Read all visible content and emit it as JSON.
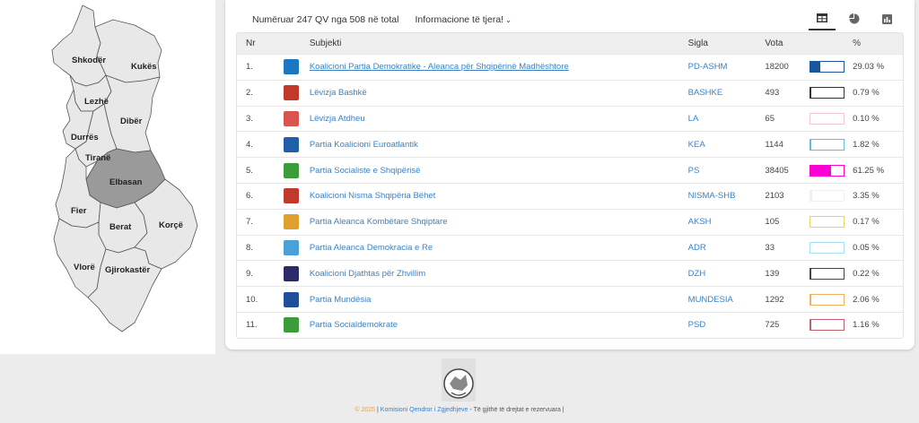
{
  "map": {
    "regions": [
      {
        "name": "Shkodër",
        "color": "#e8e8e8"
      },
      {
        "name": "Kukës",
        "color": "#e8e8e8"
      },
      {
        "name": "Lezhë",
        "color": "#e8e8e8"
      },
      {
        "name": "Dibër",
        "color": "#e8e8e8"
      },
      {
        "name": "Durrës",
        "color": "#e8e8e8"
      },
      {
        "name": "Tiranë",
        "color": "#e8e8e8"
      },
      {
        "name": "Elbasan",
        "color": "#9a9a9a"
      },
      {
        "name": "Fier",
        "color": "#e8e8e8"
      },
      {
        "name": "Berat",
        "color": "#e8e8e8"
      },
      {
        "name": "Korçë",
        "color": "#e8e8e8"
      },
      {
        "name": "Vlorë",
        "color": "#e8e8e8"
      },
      {
        "name": "Gjirokastër",
        "color": "#e8e8e8"
      }
    ]
  },
  "topbar": {
    "counted": "Numëruar 247 QV nga 508 në total",
    "more_info": "Informacione të tjera!"
  },
  "view_tabs": [
    {
      "icon": "table-icon",
      "active": true
    },
    {
      "icon": "pie-chart-icon",
      "active": false
    },
    {
      "icon": "bar-chart-icon",
      "active": false
    }
  ],
  "table": {
    "headers": {
      "nr": "Nr",
      "subjekti": "Subjekti",
      "sigla": "Sigla",
      "vota": "Vota",
      "pct": "%"
    },
    "rows": [
      {
        "nr": "1.",
        "subjekti": "Koalicioni Partia Demokratike - Aleanca për Shqipërinë Madhështore",
        "sigla": "PD-ASHM",
        "vota": "18200",
        "pct": "29.03 %",
        "share": 0.2903,
        "color": "#1a56a0",
        "logo_color": "#1a78c2"
      },
      {
        "nr": "2.",
        "subjekti": "Lëvizja Bashkë",
        "sigla": "BASHKE",
        "vota": "493",
        "pct": "0.79 %",
        "share": 0.0079,
        "color": "#333333",
        "logo_color": "#c0392b"
      },
      {
        "nr": "3.",
        "subjekti": "Lëvizja Atdheu",
        "sigla": "LA",
        "vota": "65",
        "pct": "0.10 %",
        "share": 0.001,
        "color": "#f0c8d0",
        "logo_color": "#d9534f"
      },
      {
        "nr": "4.",
        "subjekti": "Partia Koalicioni Euroatlantik",
        "sigla": "KEA",
        "vota": "1144",
        "pct": "1.82 %",
        "share": 0.0182,
        "color": "#5bc0de",
        "logo_color": "#1f5fa8"
      },
      {
        "nr": "5.",
        "subjekti": "Partia Socialiste e Shqipërisë",
        "sigla": "PS",
        "vota": "38405",
        "pct": "61.25 %",
        "share": 0.6125,
        "color": "#ff00d4",
        "logo_color": "#3a9d3a"
      },
      {
        "nr": "6.",
        "subjekti": "Koalicioni Nisma Shqipëria Bëhet",
        "sigla": "NISMA-SHB",
        "vota": "2103",
        "pct": "3.35 %",
        "share": 0.0335,
        "color": "#f0f0f0",
        "logo_color": "#c0392b"
      },
      {
        "nr": "7.",
        "subjekti": "Partia Aleanca Kombëtare Shqiptare",
        "sigla": "AKSH",
        "vota": "105",
        "pct": "0.17 %",
        "share": 0.0017,
        "color": "#f0d060",
        "logo_color": "#e0a030"
      },
      {
        "nr": "8.",
        "subjekti": "Partia Aleanca Demokracia e Re",
        "sigla": "ADR",
        "vota": "33",
        "pct": "0.05 %",
        "share": 0.0005,
        "color": "#a8e0f0",
        "logo_color": "#4aa0d8"
      },
      {
        "nr": "9.",
        "subjekti": "Koalicioni Djathtas për Zhvillim",
        "sigla": "DZH",
        "vota": "139",
        "pct": "0.22 %",
        "share": 0.0022,
        "color": "#444444",
        "logo_color": "#2b2b6b"
      },
      {
        "nr": "10.",
        "subjekti": "Partia Mundësia",
        "sigla": "MUNDESIA",
        "vota": "1292",
        "pct": "2.06 %",
        "share": 0.0206,
        "color": "#f0b060",
        "logo_color": "#1f4f9a"
      },
      {
        "nr": "11.",
        "subjekti": "Partia Socialdemokrate",
        "sigla": "PSD",
        "vota": "725",
        "pct": "1.16 %",
        "share": 0.0116,
        "color": "#c06070",
        "logo_color": "#3a9d3a"
      }
    ]
  },
  "footer": {
    "year": "© 2025",
    "sep1": " | ",
    "org": "Komisioni Qendror i Zgjedhjeve",
    "rights": " - Të gjithë të drejtat e rezervuara |"
  }
}
